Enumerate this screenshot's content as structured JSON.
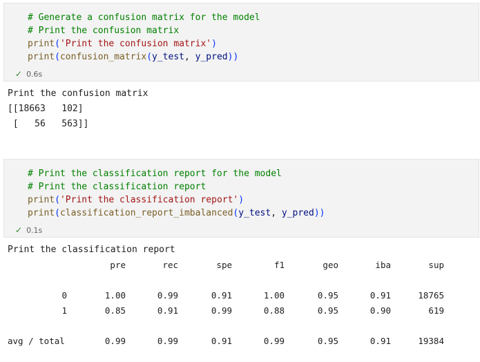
{
  "cell1": {
    "lines": [
      {
        "comment": "# Generate a confusion matrix for the model"
      },
      {
        "comment": "# Print the confusion matrix"
      },
      {
        "fn": "print",
        "open": "(",
        "str": "'Print the confusion matrix'",
        "close": ")"
      },
      {
        "fn": "print",
        "open": "(",
        "fn2": "confusion_matrix",
        "open2": "(",
        "a1": "y_test",
        "sep": ", ",
        "a2": "y_pred",
        "close2": ")",
        "close": ")"
      }
    ],
    "status": {
      "check": "✓",
      "time": "0.6s"
    }
  },
  "output1": {
    "lines": [
      "Print the confusion matrix",
      "[[18663   102]",
      " [   56   563]]"
    ]
  },
  "cell2": {
    "lines": [
      {
        "comment": "# Print the classification report for the model"
      },
      {
        "comment": "# Print the classification report"
      },
      {
        "fn": "print",
        "open": "(",
        "str": "'Print the classification report'",
        "close": ")"
      },
      {
        "fn": "print",
        "open": "(",
        "fn2": "classification_report_imbalanced",
        "open2": "(",
        "a1": "y_test",
        "sep": ", ",
        "a2": "y_pred",
        "close2": ")",
        "close": ")"
      }
    ],
    "status": {
      "check": "✓",
      "time": "0.1s"
    }
  },
  "output2": {
    "title": "Print the classification report",
    "headers": [
      "pre",
      "rec",
      "spe",
      "f1",
      "geo",
      "iba",
      "sup"
    ],
    "rows": [
      {
        "label": "0",
        "values": [
          "1.00",
          "0.99",
          "0.91",
          "1.00",
          "0.95",
          "0.91",
          "18765"
        ]
      },
      {
        "label": "1",
        "values": [
          "0.85",
          "0.91",
          "0.99",
          "0.88",
          "0.95",
          "0.90",
          "619"
        ]
      },
      {
        "label": "avg / total",
        "values": [
          "0.99",
          "0.99",
          "0.91",
          "0.99",
          "0.95",
          "0.91",
          "19384"
        ]
      }
    ]
  }
}
